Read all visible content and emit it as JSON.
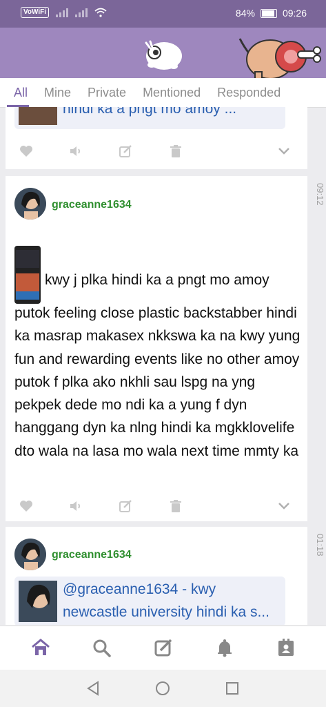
{
  "status_bar": {
    "network_label": "VoWiFi",
    "battery_percent": "84%",
    "time": "09:26"
  },
  "tabs": [
    {
      "label": "All",
      "active": true
    },
    {
      "label": "Mine",
      "active": false
    },
    {
      "label": "Private",
      "active": false
    },
    {
      "label": "Mentioned",
      "active": false
    },
    {
      "label": "Responded",
      "active": false
    }
  ],
  "feed": {
    "card1": {
      "quote_text": "hindi ka a pngt mo amoy ..."
    },
    "card2": {
      "time": "09:12",
      "username": "graceanne1634",
      "text_line1": "kwy j plka hindi ka a pngt mo amoy",
      "text_rest": "putok feeling close plastic backstabber hindi ka masrap makasex nkkswa ka na kwy yung fun and rewarding events like no other amoy putok f plka ako nkhli sau lspg na yng pekpek dede mo ndi ka a yung f dyn hanggang dyn ka nlng hindi ka mgkklovelife dto wala na lasa mo wala next time mmty ka"
    },
    "card3": {
      "time": "01:18",
      "username": "graceanne1634",
      "quote_text": "@graceanne1634 - kwy newcastle university hindi ka s..."
    }
  },
  "colors": {
    "status_bar": "#7b6699",
    "header": "#9e87be",
    "accent": "#7b65a8",
    "username": "#2f8f2f",
    "link": "#2a5fb0"
  }
}
